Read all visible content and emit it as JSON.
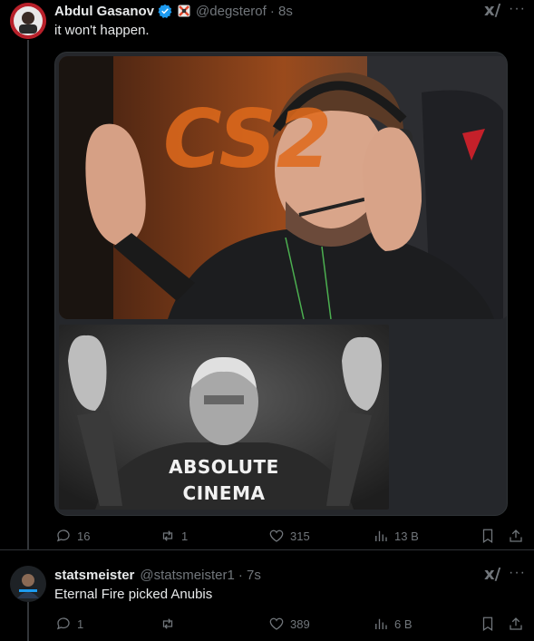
{
  "tweet1": {
    "name": "Abdul Gasanov",
    "handle": "@degsterof",
    "time": "· 8s",
    "text": "it won't happen.",
    "image_caption_line1": "ABSOLUTE",
    "image_caption_line2": "CINEMA",
    "stream_text": "CS2",
    "actions": {
      "replies": "16",
      "reposts": "1",
      "likes": "315",
      "views": "13 B"
    }
  },
  "tweet2": {
    "name": "statsmeister",
    "handle": "@statsmeister1",
    "time": "· 7s",
    "text": "Eternal Fire picked Anubis",
    "actions": {
      "replies": "1",
      "reposts": "",
      "likes": "389",
      "views": "6 B"
    }
  },
  "ui": {
    "grok_label": "x/",
    "more_label": "···"
  },
  "colors": {
    "background": "#000000",
    "muted": "#71767b",
    "accent": "#1d9bf0",
    "border": "#2f3336"
  },
  "icons": [
    "verified-badge-icon",
    "affiliate-badge-icon",
    "grok-icon",
    "more-icon",
    "reply-icon",
    "repost-icon",
    "like-icon",
    "views-icon",
    "bookmark-icon",
    "share-icon"
  ]
}
